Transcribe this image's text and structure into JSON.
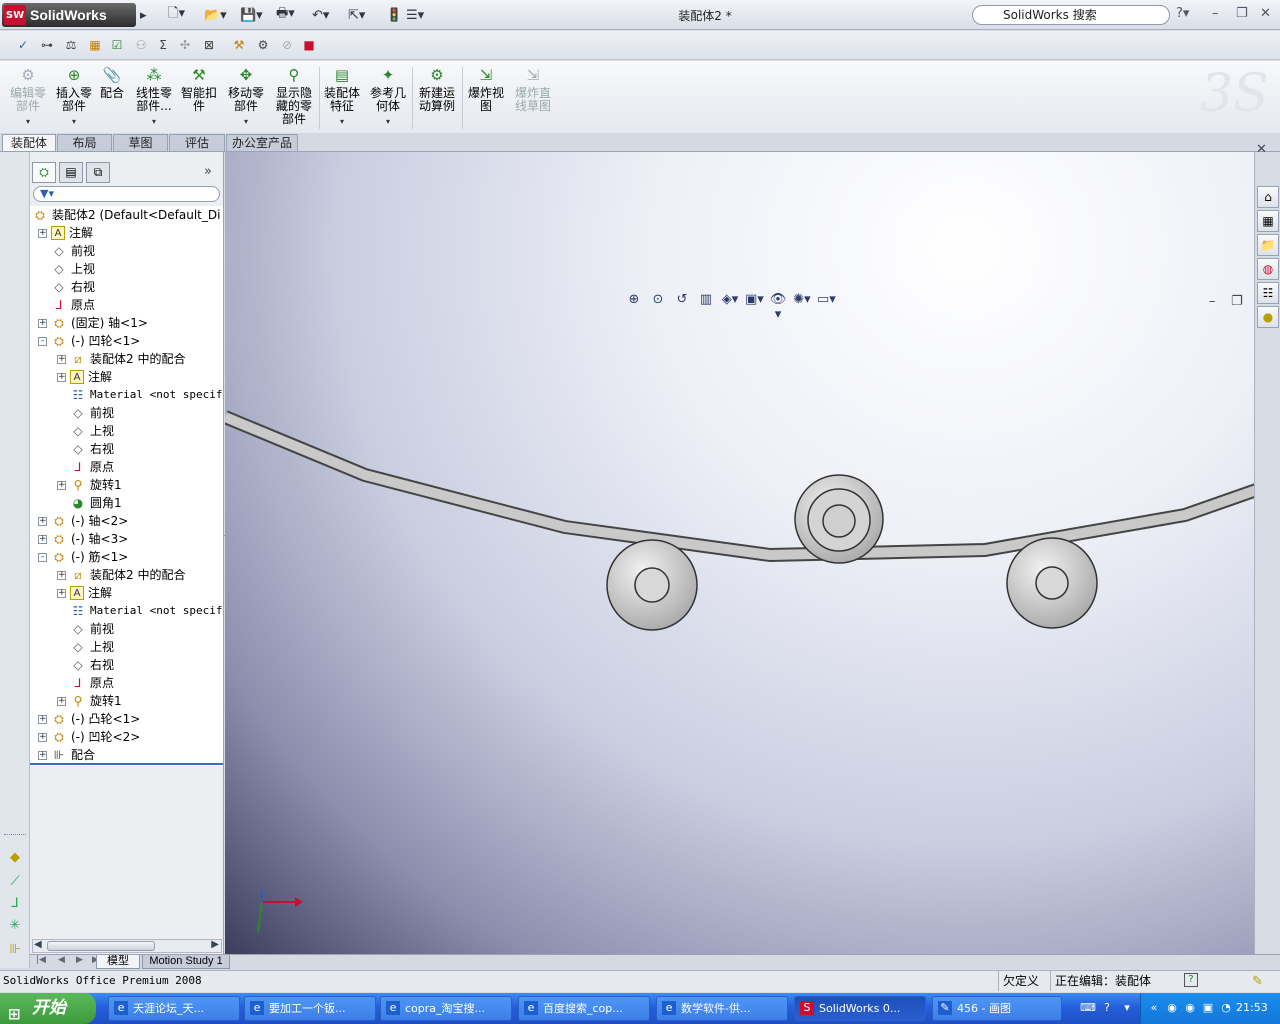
{
  "app": {
    "logo_text": "SolidWorks",
    "logo_mark": "SW",
    "document_title": "装配体2 *",
    "search_placeholder": "SolidWorks 搜索",
    "help_label": "?",
    "brand_watermark": "3S"
  },
  "command_manager": {
    "buttons": [
      {
        "label": "编辑零\n部件",
        "enabled": false,
        "icon": "edit-component-icon"
      },
      {
        "label": "插入零\n部件",
        "enabled": true,
        "icon": "insert-components-icon"
      },
      {
        "label": "配合",
        "enabled": true,
        "icon": "mate-icon"
      },
      {
        "label": "线性零\n部件...",
        "enabled": true,
        "icon": "linear-pattern-icon"
      },
      {
        "label": "智能扣\n件",
        "enabled": true,
        "icon": "smart-fasteners-icon"
      },
      {
        "label": "移动零\n部件",
        "enabled": true,
        "icon": "move-component-icon"
      },
      {
        "label": "显示隐\n藏的零\n部件",
        "enabled": true,
        "icon": "show-hidden-icon"
      },
      {
        "label": "装配体\n特征",
        "enabled": true,
        "icon": "assembly-features-icon"
      },
      {
        "label": "参考几\n何体",
        "enabled": true,
        "icon": "reference-geometry-icon"
      },
      {
        "label": "新建运\n动算例",
        "enabled": true,
        "icon": "new-motion-study-icon"
      },
      {
        "label": "爆炸视\n图",
        "enabled": true,
        "icon": "exploded-view-icon"
      },
      {
        "label": "爆炸直\n线草图",
        "enabled": false,
        "icon": "explode-line-sketch-icon"
      }
    ],
    "tabs": [
      "装配体",
      "布局",
      "草图",
      "评估",
      "办公室产品"
    ],
    "active_tab": "装配体"
  },
  "feature_tree": {
    "root": "装配体2  (Default<Default_Di",
    "nodes": [
      {
        "label": "注解",
        "level": 1,
        "expander": "+",
        "icon": "annotations-icon"
      },
      {
        "label": "前视",
        "level": 1,
        "expander": "",
        "icon": "plane-icon"
      },
      {
        "label": "上视",
        "level": 1,
        "expander": "",
        "icon": "plane-icon"
      },
      {
        "label": "右视",
        "level": 1,
        "expander": "",
        "icon": "plane-icon"
      },
      {
        "label": "原点",
        "level": 1,
        "expander": "",
        "icon": "origin-icon"
      },
      {
        "label": "(固定) 轴<1>",
        "level": 1,
        "expander": "+",
        "icon": "part-icon"
      },
      {
        "label": "(-) 凹轮<1>",
        "level": 1,
        "expander": "-",
        "icon": "part-icon"
      },
      {
        "label": "装配体2 中的配合",
        "level": 2,
        "expander": "+",
        "icon": "mates-in-assembly-icon"
      },
      {
        "label": "注解",
        "level": 2,
        "expander": "+",
        "icon": "annotations-icon"
      },
      {
        "label": "Material <not specifie",
        "level": 2,
        "expander": "",
        "icon": "material-icon",
        "mono": true
      },
      {
        "label": "前视",
        "level": 2,
        "expander": "",
        "icon": "plane-icon"
      },
      {
        "label": "上视",
        "level": 2,
        "expander": "",
        "icon": "plane-icon"
      },
      {
        "label": "右视",
        "level": 2,
        "expander": "",
        "icon": "plane-icon"
      },
      {
        "label": "原点",
        "level": 2,
        "expander": "",
        "icon": "origin-icon"
      },
      {
        "label": "旋转1",
        "level": 2,
        "expander": "+",
        "icon": "revolve-icon"
      },
      {
        "label": "圆角1",
        "level": 2,
        "expander": "",
        "icon": "fillet-icon"
      },
      {
        "label": "(-) 轴<2>",
        "level": 1,
        "expander": "+",
        "icon": "part-icon"
      },
      {
        "label": "(-) 轴<3>",
        "level": 1,
        "expander": "+",
        "icon": "part-icon"
      },
      {
        "label": "(-) 筋<1>",
        "level": 1,
        "expander": "-",
        "icon": "part-icon"
      },
      {
        "label": "装配体2 中的配合",
        "level": 2,
        "expander": "+",
        "icon": "mates-in-assembly-icon"
      },
      {
        "label": "注解",
        "level": 2,
        "expander": "+",
        "icon": "annotations-icon"
      },
      {
        "label": "Material <not specifie",
        "level": 2,
        "expander": "",
        "icon": "material-icon",
        "mono": true
      },
      {
        "label": "前视",
        "level": 2,
        "expander": "",
        "icon": "plane-icon"
      },
      {
        "label": "上视",
        "level": 2,
        "expander": "",
        "icon": "plane-icon"
      },
      {
        "label": "右视",
        "level": 2,
        "expander": "",
        "icon": "plane-icon"
      },
      {
        "label": "原点",
        "level": 2,
        "expander": "",
        "icon": "origin-icon"
      },
      {
        "label": "旋转1",
        "level": 2,
        "expander": "+",
        "icon": "revolve-icon"
      },
      {
        "label": "(-) 凸轮<1>",
        "level": 1,
        "expander": "+",
        "icon": "part-icon"
      },
      {
        "label": "(-) 凹轮<2>",
        "level": 1,
        "expander": "+",
        "icon": "part-icon"
      },
      {
        "label": "配合",
        "level": 1,
        "expander": "+",
        "icon": "mates-icon"
      }
    ]
  },
  "bottom_tabs": [
    "模型",
    "Motion Study 1"
  ],
  "active_bottom_tab": "模型",
  "status_bar": {
    "product": "SolidWorks Office Premium 2008",
    "definition": "欠定义",
    "editing": "正在编辑：装配体"
  },
  "taskbar": {
    "start_label": "开始",
    "tasks": [
      {
        "label": "天涯论坛_天...",
        "icon": "ie-icon"
      },
      {
        "label": "要加工一个钣...",
        "icon": "ie-icon"
      },
      {
        "label": "copra_淘宝搜...",
        "icon": "ie-icon"
      },
      {
        "label": "百度搜索_cop...",
        "icon": "ie-icon"
      },
      {
        "label": "数学软件-供...",
        "icon": "ie-icon"
      },
      {
        "label": "SolidWorks 0...",
        "icon": "solidworks-icon",
        "active": true
      },
      {
        "label": "456 - 画图",
        "icon": "paint-icon"
      }
    ],
    "clock": "21:53"
  },
  "colors": {
    "accent": "#3a6fbf",
    "taskbar_blue": "#245edb",
    "start_green": "#3c9a3c",
    "logo_red": "#c8102e"
  }
}
